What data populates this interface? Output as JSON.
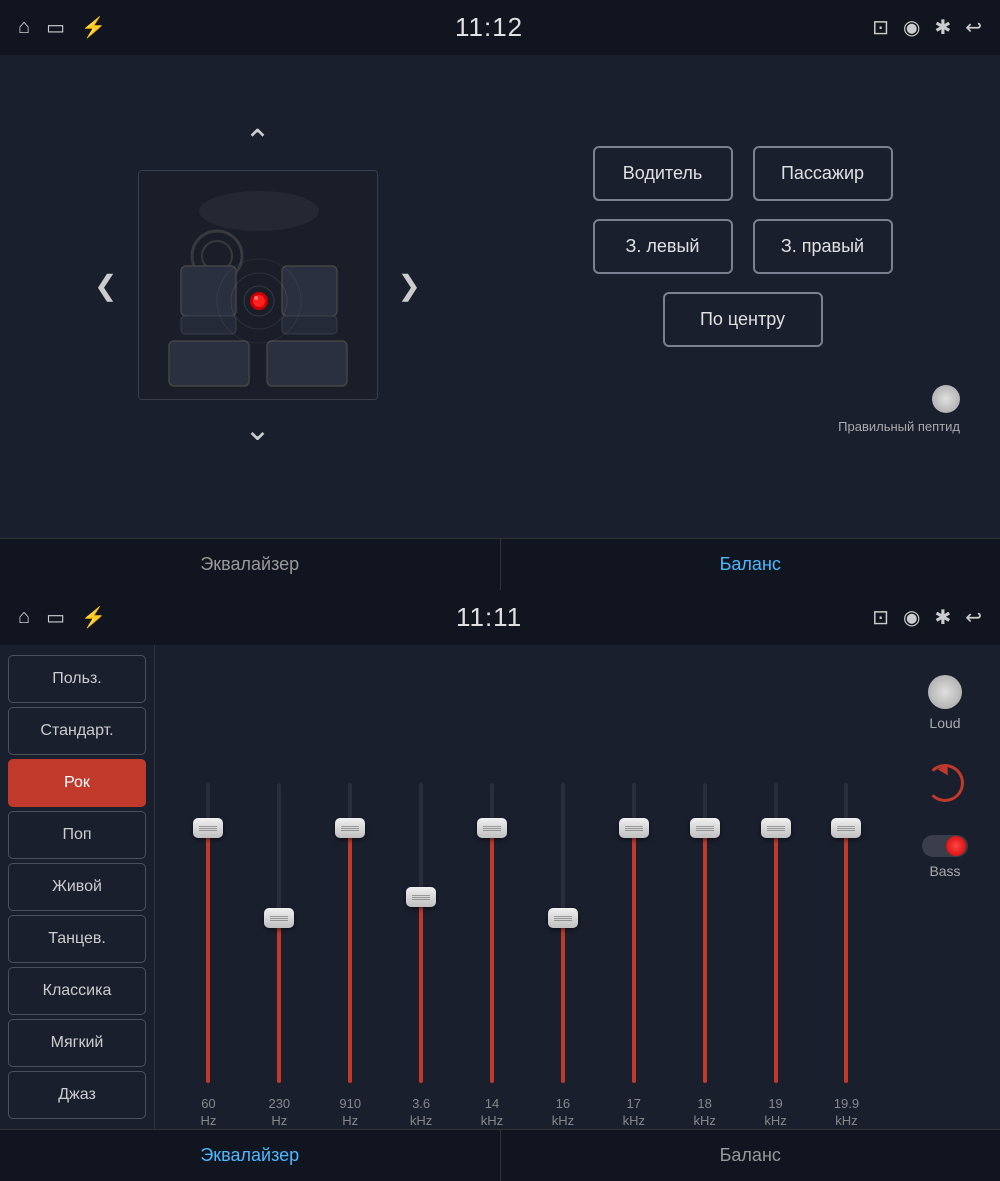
{
  "top_panel": {
    "status_bar": {
      "time": "11:12",
      "icons_left": [
        "home-icon",
        "screen-icon",
        "usb-icon"
      ],
      "icons_right": [
        "cast-icon",
        "location-icon",
        "bluetooth-icon",
        "back-icon"
      ]
    },
    "seat_buttons": {
      "driver": "Водитель",
      "passenger": "Пассажир",
      "rear_left": "З. левый",
      "rear_right": "З. правый",
      "center": "По центру"
    },
    "toggle_label": "Правильный пептид",
    "tabs": [
      {
        "label": "Эквалайзер",
        "active": false
      },
      {
        "label": "Баланс",
        "active": true
      }
    ]
  },
  "bottom_panel": {
    "status_bar": {
      "time": "11:11",
      "icons_left": [
        "home-icon",
        "screen-icon",
        "usb-icon"
      ],
      "icons_right": [
        "cast-icon",
        "location-icon",
        "bluetooth-icon",
        "back-icon"
      ]
    },
    "presets": [
      {
        "label": "Польз.",
        "active": false
      },
      {
        "label": "Стандарт.",
        "active": false
      },
      {
        "label": "Рок",
        "active": true
      },
      {
        "label": "Поп",
        "active": false
      },
      {
        "label": "Живой",
        "active": false
      },
      {
        "label": "Танцев.",
        "active": false
      },
      {
        "label": "Классика",
        "active": false
      },
      {
        "label": "Мягкий",
        "active": false
      },
      {
        "label": "Джаз",
        "active": false
      }
    ],
    "eq_bands": [
      {
        "freq": "60",
        "unit": "Hz",
        "fill_pct": 85,
        "thumb_pct": 85
      },
      {
        "freq": "230",
        "unit": "Hz",
        "fill_pct": 55,
        "thumb_pct": 55
      },
      {
        "freq": "910",
        "unit": "Hz",
        "fill_pct": 85,
        "thumb_pct": 85
      },
      {
        "freq": "3.6",
        "unit": "kHz",
        "fill_pct": 62,
        "thumb_pct": 62
      },
      {
        "freq": "14",
        "unit": "kHz",
        "fill_pct": 85,
        "thumb_pct": 85
      },
      {
        "freq": "16",
        "unit": "kHz",
        "fill_pct": 55,
        "thumb_pct": 55
      },
      {
        "freq": "17",
        "unit": "kHz",
        "fill_pct": 85,
        "thumb_pct": 85
      },
      {
        "freq": "18",
        "unit": "kHz",
        "fill_pct": 85,
        "thumb_pct": 85
      },
      {
        "freq": "19",
        "unit": "kHz",
        "fill_pct": 85,
        "thumb_pct": 85
      },
      {
        "freq": "19.9",
        "unit": "kHz",
        "fill_pct": 85,
        "thumb_pct": 85
      }
    ],
    "controls": {
      "loud_label": "Loud",
      "bass_label": "Bass"
    },
    "tabs": [
      {
        "label": "Эквалайзер",
        "active": true
      },
      {
        "label": "Баланс",
        "active": false
      }
    ]
  }
}
